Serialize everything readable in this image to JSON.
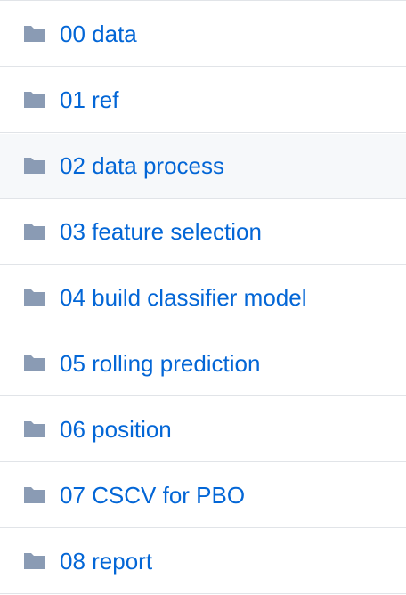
{
  "colors": {
    "link": "#0366d6",
    "folder_icon": "#79b8ff",
    "border": "#e1e4e8",
    "hover_row": "#f6f8fa"
  },
  "folders": [
    {
      "label": "00 data",
      "icon": "folder-icon"
    },
    {
      "label": "01 ref",
      "icon": "folder-icon"
    },
    {
      "label": "02 data process",
      "icon": "folder-icon"
    },
    {
      "label": "03 feature selection",
      "icon": "folder-icon"
    },
    {
      "label": "04 build classifier model",
      "icon": "folder-icon"
    },
    {
      "label": "05 rolling prediction",
      "icon": "folder-icon"
    },
    {
      "label": "06 position",
      "icon": "folder-icon"
    },
    {
      "label": "07 CSCV for PBO",
      "icon": "folder-icon"
    },
    {
      "label": "08 report",
      "icon": "folder-icon"
    }
  ]
}
